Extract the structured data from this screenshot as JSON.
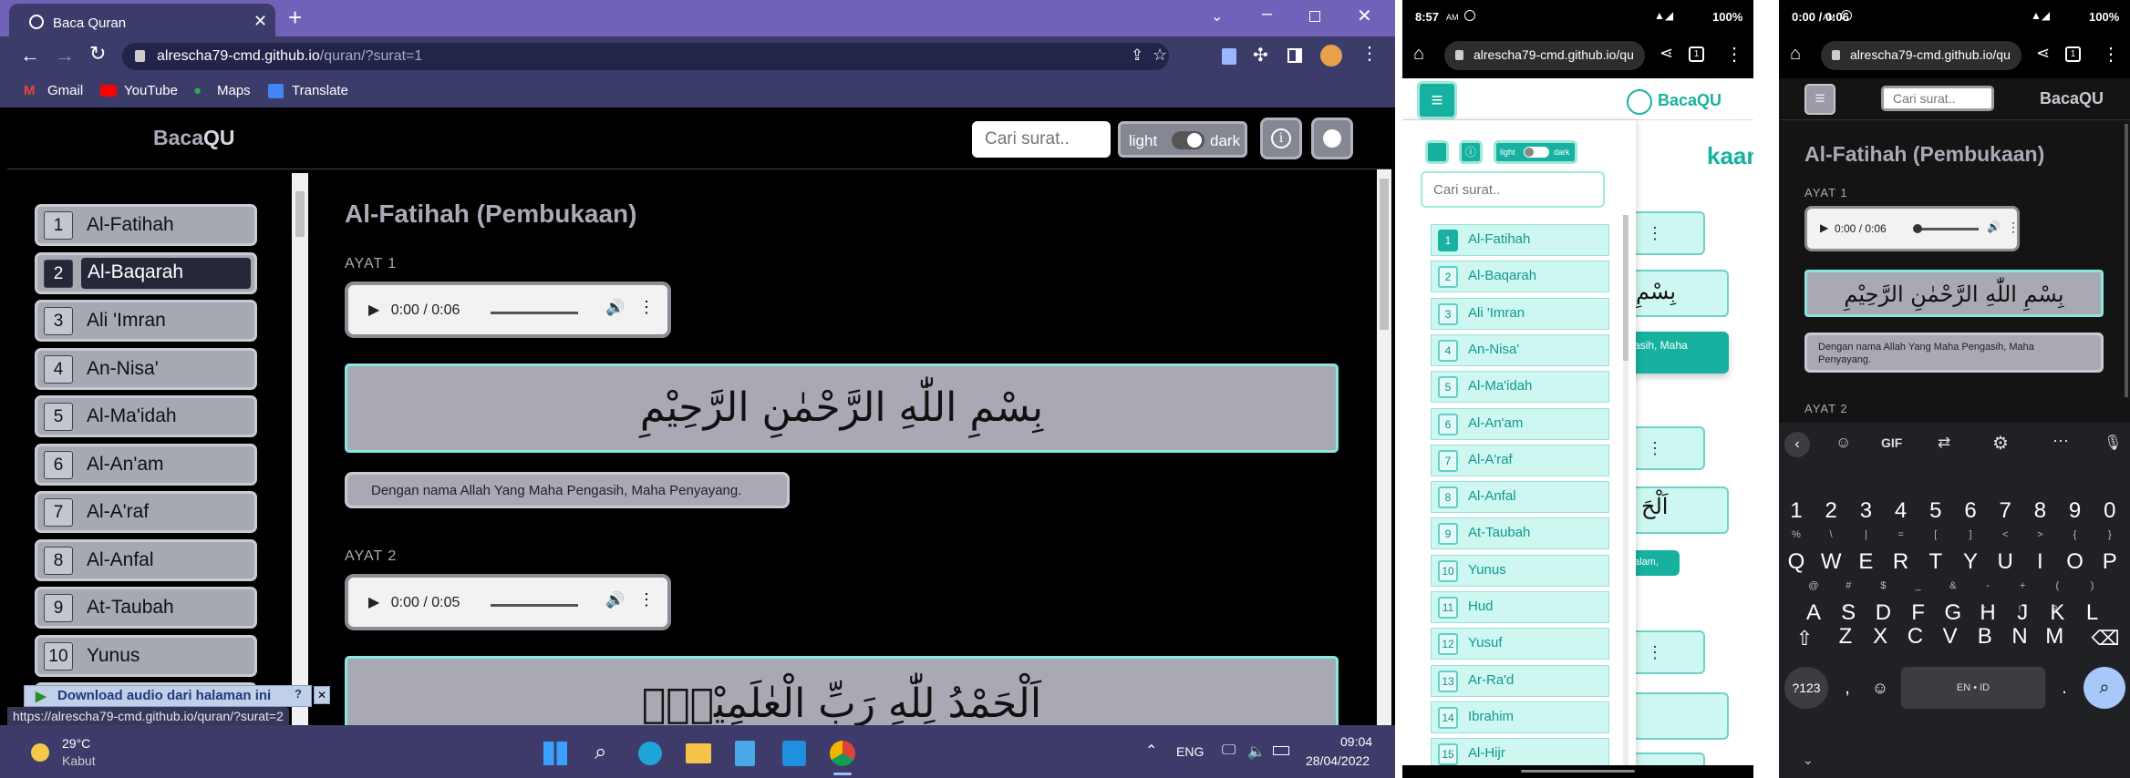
{
  "desktop": {
    "tab_title": "Baca Quran",
    "url_domain": "alrescha79-cmd.github.io",
    "url_path": "/quran/?surat=1",
    "bookmarks": [
      "Gmail",
      "YouTube",
      "Maps",
      "Translate"
    ],
    "brand_pre": "Baca",
    "brand_post": "QU",
    "search_placeholder": "Cari surat..",
    "theme_light": "light",
    "theme_dark": "dark",
    "surah_list": [
      {
        "num": "1",
        "name": "Al-Fatihah"
      },
      {
        "num": "2",
        "name": "Al-Baqarah"
      },
      {
        "num": "3",
        "name": "Ali 'Imran"
      },
      {
        "num": "4",
        "name": "An-Nisa'"
      },
      {
        "num": "5",
        "name": "Al-Ma'idah"
      },
      {
        "num": "6",
        "name": "Al-An'am"
      },
      {
        "num": "7",
        "name": "Al-A'raf"
      },
      {
        "num": "8",
        "name": "Al-Anfal"
      },
      {
        "num": "9",
        "name": "At-Taubah"
      },
      {
        "num": "10",
        "name": "Yunus"
      }
    ],
    "surah_title": "Al-Fatihah (Pembukaan)",
    "ayat": [
      {
        "label": "AYAT 1",
        "time": "0:00 / 0:06",
        "arabic": "بِسْمِ اللّٰهِ الرَّحْمٰنِ الرَّحِيْمِ",
        "translation": "Dengan nama Allah Yang Maha Pengasih, Maha Penyayang."
      },
      {
        "label": "AYAT 2",
        "time": "0:00 / 0:05",
        "arabic": "اَلْحَمْدُ لِلّٰهِ رَبِّ الْعٰلَمِيْنَۙ"
      }
    ],
    "download_banner": "Download audio dari halaman ini",
    "status_url": "https://alrescha79-cmd.github.io/quran/?surat=2",
    "weather_temp": "29°C",
    "weather_text": "Kabut",
    "lang": "ENG",
    "clock_time": "09:04",
    "clock_date": "28/04/2022"
  },
  "phone1": {
    "time": "8:57",
    "ampm": "AM",
    "battery": "100%",
    "url": "alrescha79-cmd.github.io/qu",
    "brand": "BacaQU",
    "theme_light": "light",
    "theme_dark": "dark",
    "search_placeholder": "Cari surat..",
    "surah_list": [
      {
        "num": "1",
        "name": "Al-Fatihah"
      },
      {
        "num": "2",
        "name": "Al-Baqarah"
      },
      {
        "num": "3",
        "name": "Ali 'Imran"
      },
      {
        "num": "4",
        "name": "An-Nisa'"
      },
      {
        "num": "5",
        "name": "Al-Ma'idah"
      },
      {
        "num": "6",
        "name": "Al-An'am"
      },
      {
        "num": "7",
        "name": "Al-A'raf"
      },
      {
        "num": "8",
        "name": "Al-Anfal"
      },
      {
        "num": "9",
        "name": "At-Taubah"
      },
      {
        "num": "10",
        "name": "Yunus"
      },
      {
        "num": "11",
        "name": "Hud"
      },
      {
        "num": "12",
        "name": "Yusuf"
      },
      {
        "num": "13",
        "name": "Ar-Ra'd"
      },
      {
        "num": "14",
        "name": "Ibrahim"
      },
      {
        "num": "15",
        "name": "Al-Hijr"
      }
    ],
    "bg_title_fragment": "kaan)",
    "bg_trans1_fragment": "asih, Maha",
    "bg_trans2_fragment": "alam,"
  },
  "phone2": {
    "time": "0:00 / 0:06",
    "ampm": "AM",
    "battery": "100%",
    "url": "alrescha79-cmd.github.io/qu",
    "search_placeholder": "Cari surat..",
    "brand": "BacaQU",
    "surah_title": "Al-Fatihah (Pembukaan)",
    "ayat1_label": "AYAT 1",
    "arabic": "بِسْمِ اللّٰهِ الرَّحْمٰنِ الرَّحِيْمِ",
    "translation": "Dengan nama Allah Yang Maha Pengasih, Maha Penyayang.",
    "ayat2_label": "AYAT 2",
    "keyboard": {
      "gif": "GIF",
      "digits": [
        "1",
        "2",
        "3",
        "4",
        "5",
        "6",
        "7",
        "8",
        "9",
        "0"
      ],
      "row1": [
        "Q",
        "W",
        "E",
        "R",
        "T",
        "Y",
        "U",
        "I",
        "O",
        "P"
      ],
      "row1_sup": [
        "%",
        "\\",
        "|",
        "=",
        "[",
        "]",
        "<",
        ">",
        "{",
        "}"
      ],
      "row2": [
        "A",
        "S",
        "D",
        "F",
        "G",
        "H",
        "J",
        "K",
        "L"
      ],
      "row2_sup": [
        "@",
        "#",
        "$",
        "_",
        "&",
        "-",
        "+",
        "(",
        ")"
      ],
      "row3": [
        "Z",
        "X",
        "C",
        "V",
        "B",
        "N",
        "M"
      ],
      "row3_sup": [
        "*",
        "\"",
        "'",
        ":",
        ";",
        "!",
        "?"
      ],
      "sym": "?123",
      "comma": ",",
      "space": "EN • ID",
      "period": "."
    }
  }
}
